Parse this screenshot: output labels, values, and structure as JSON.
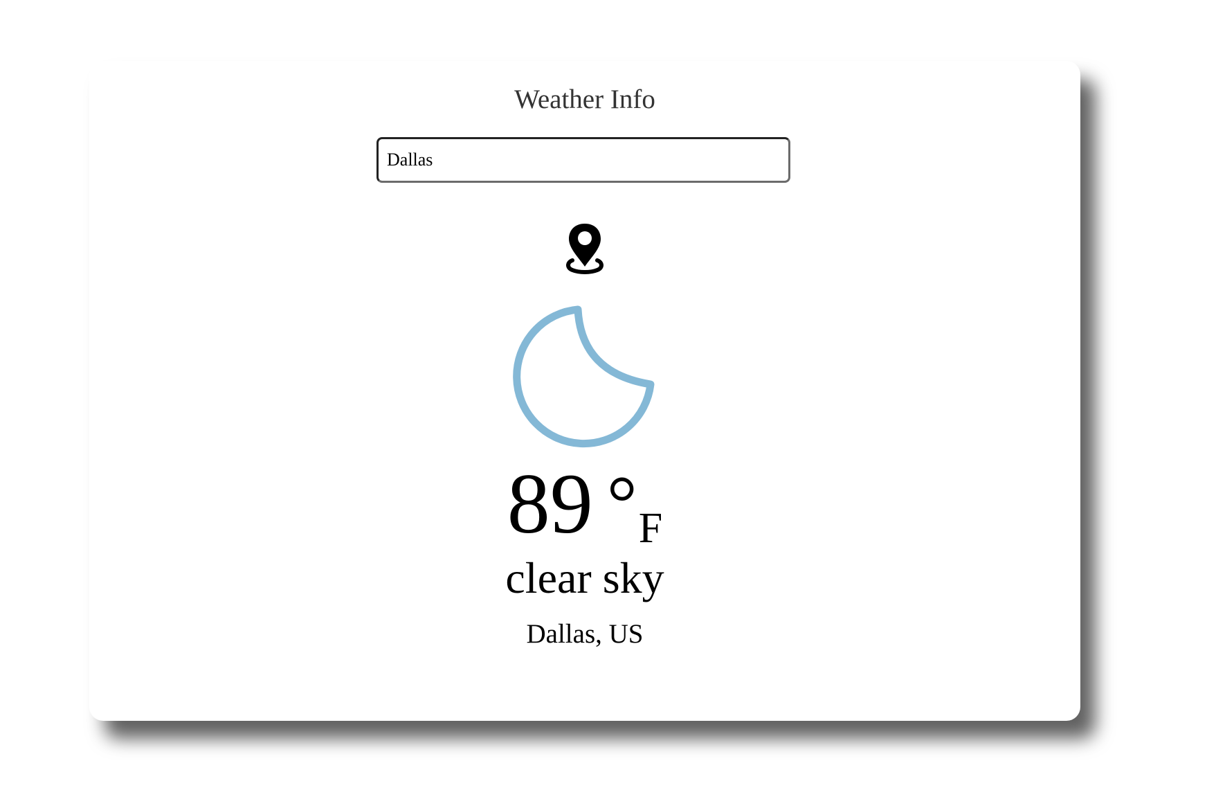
{
  "app": {
    "title": "Weather Info"
  },
  "search": {
    "value": "Dallas",
    "placeholder": ""
  },
  "icons": {
    "location": "location-pin-icon",
    "weather": "crescent-moon-icon",
    "weather_color": "#84b8d6"
  },
  "weather": {
    "temperature": "89",
    "degree_symbol": "°",
    "unit": "F",
    "description": "clear sky",
    "location": "Dallas, US"
  }
}
